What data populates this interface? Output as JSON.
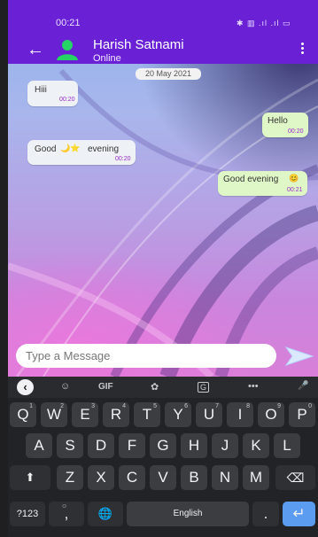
{
  "status_bar": {
    "time": "00:21",
    "icons": "✱ ▥ .ıl .ıl ▭"
  },
  "header": {
    "back_icon": "←",
    "contact_name": "Harish Satnami",
    "presence": "Online",
    "menu_icon": "⋮"
  },
  "chat": {
    "date_chip": "20 May 2021",
    "messages": [
      {
        "direction": "in",
        "text": "Hiii",
        "time": "00:20"
      },
      {
        "direction": "out",
        "text": "Hello",
        "time": "00:20"
      },
      {
        "direction": "in",
        "text": "Good",
        "emoji": "🌙⭐",
        "text_after": "evening",
        "time": "00:20"
      },
      {
        "direction": "out",
        "text": "Good evening",
        "emoji": "😊",
        "time": "00:21"
      }
    ]
  },
  "composer": {
    "placeholder": "Type a Message",
    "send_icon": "send-icon"
  },
  "keyboard": {
    "toolbar": {
      "collapse": "‹",
      "sticker": "☺",
      "gif": "GIF",
      "settings": "✿",
      "translate": "G",
      "more": "•••",
      "mic": "🎤"
    },
    "row1": [
      {
        "key": "Q",
        "hint": "1"
      },
      {
        "key": "W",
        "hint": "2"
      },
      {
        "key": "E",
        "hint": "3"
      },
      {
        "key": "R",
        "hint": "4"
      },
      {
        "key": "T",
        "hint": "5"
      },
      {
        "key": "Y",
        "hint": "6"
      },
      {
        "key": "U",
        "hint": "7"
      },
      {
        "key": "I",
        "hint": "8"
      },
      {
        "key": "O",
        "hint": "9"
      },
      {
        "key": "P",
        "hint": "0"
      }
    ],
    "row2": [
      "A",
      "S",
      "D",
      "F",
      "G",
      "H",
      "J",
      "K",
      "L"
    ],
    "row3": [
      "Z",
      "X",
      "C",
      "V",
      "B",
      "N",
      "M"
    ],
    "shift": "⬆",
    "backspace": "⌫",
    "symbols": "?123",
    "comma_hint": "☺",
    "comma": ",",
    "globe": "🌐",
    "space": "English",
    "period": ".",
    "enter": "↵"
  }
}
